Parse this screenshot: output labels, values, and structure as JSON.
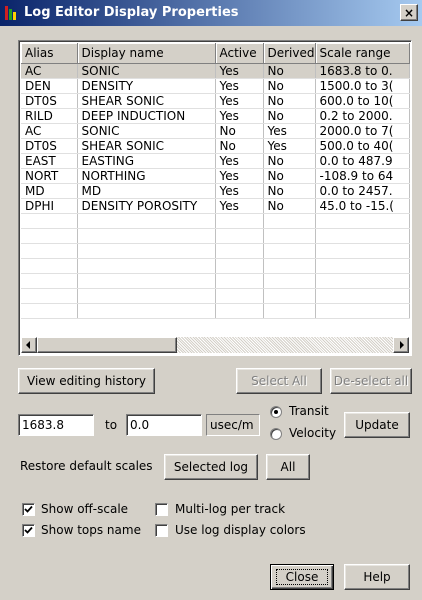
{
  "window": {
    "title": "Log Editor Display Properties",
    "close_glyph": "×",
    "icon": "log-editor-app-icon",
    "icon_colors": [
      "#d02020",
      "#20a020",
      "#ffd000"
    ]
  },
  "grid": {
    "columns": [
      "Alias",
      "Display name",
      "Active",
      "Derived",
      "Scale range"
    ],
    "rows": [
      [
        "AC",
        "SONIC",
        "Yes",
        "No",
        "1683.8 to 0."
      ],
      [
        "DEN",
        "DENSITY",
        "Yes",
        "No",
        "1500.0 to 3("
      ],
      [
        "DT0S",
        "SHEAR SONIC",
        "Yes",
        "No",
        "600.0 to 10("
      ],
      [
        "RILD",
        "DEEP INDUCTION",
        "Yes",
        "No",
        "0.2 to 2000."
      ],
      [
        "AC",
        "SONIC",
        "No",
        "Yes",
        "2000.0 to 7("
      ],
      [
        "DT0S",
        "SHEAR SONIC",
        "No",
        "Yes",
        "500.0 to 40("
      ],
      [
        "EAST",
        "EASTING",
        "Yes",
        "No",
        "0.0 to 487.9"
      ],
      [
        "NORT",
        "NORTHING",
        "Yes",
        "No",
        "-108.9 to 64"
      ],
      [
        "MD",
        "MD",
        "Yes",
        "No",
        "0.0 to 2457."
      ],
      [
        "DPHI",
        "DENSITY POROSITY",
        "Yes",
        "No",
        "45.0 to -15.("
      ]
    ],
    "selected_row": 0,
    "empty_rows": 7
  },
  "buttons": {
    "view_history": "View editing  history",
    "select_all": "Select All",
    "deselect_all": "De-select all",
    "update": "Update",
    "selected_log": "Selected log",
    "all": "All",
    "close": "Close",
    "help": "Help"
  },
  "scale": {
    "from_value": "1683.8",
    "to_label": "to",
    "to_value": "0.0",
    "unit": "usec/m",
    "radio_transit": "Transit",
    "radio_velocity": "Velocity",
    "selected_radio": "transit"
  },
  "restore_label": "Restore default scales",
  "options": {
    "show_off_scale": {
      "label": "Show off-scale",
      "checked": true
    },
    "show_tops_name": {
      "label": "Show tops name",
      "checked": true
    },
    "multi_log_per_track": {
      "label": "Multi-log per track",
      "checked": false
    },
    "use_log_display_colors": {
      "label": "Use log display colors",
      "checked": false
    }
  }
}
